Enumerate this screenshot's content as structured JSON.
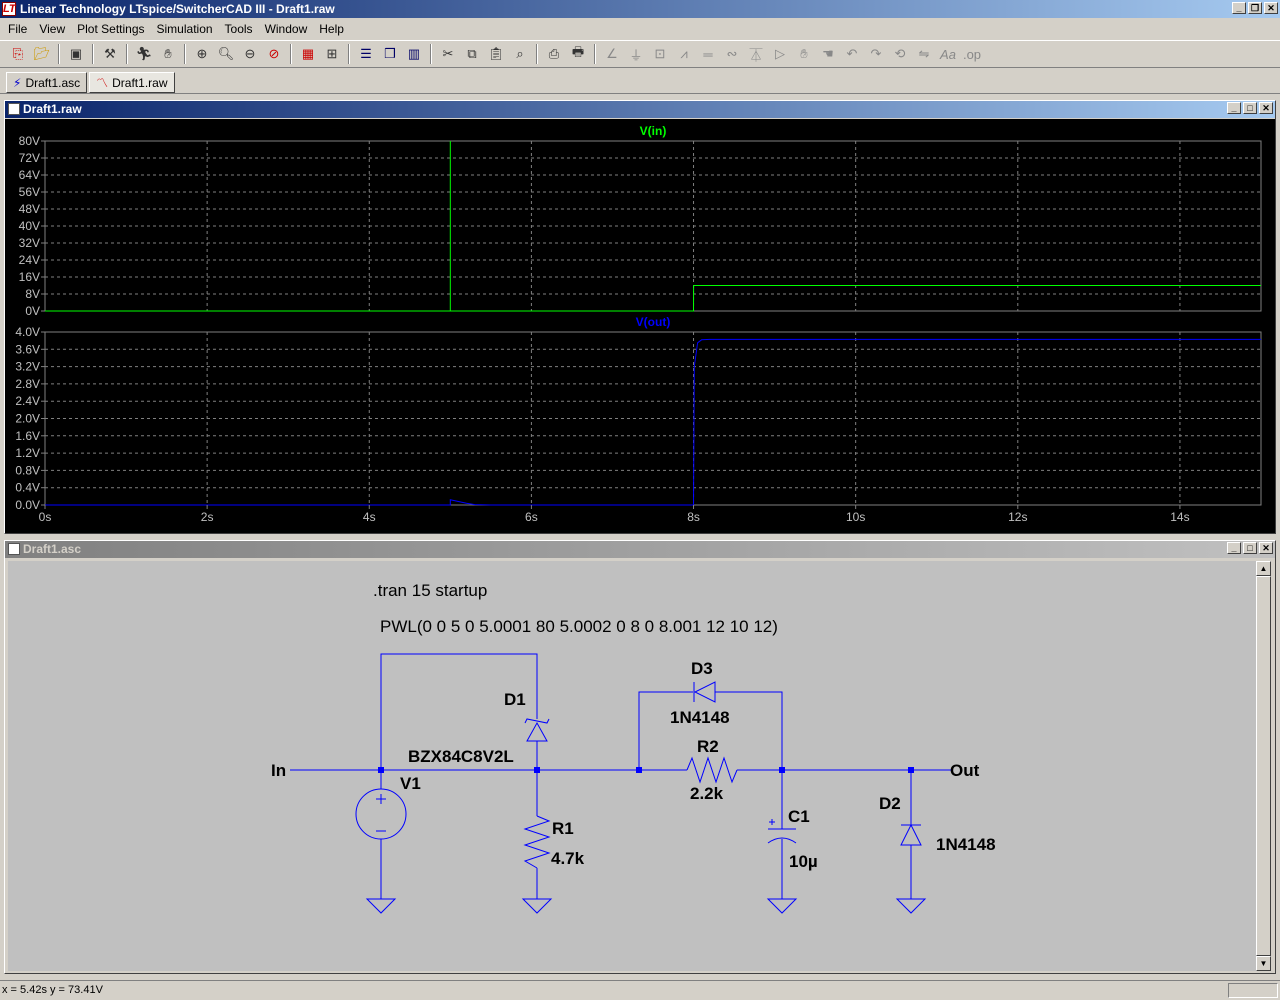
{
  "window": {
    "title": "Linear Technology LTspice/SwitcherCAD III - Draft1.raw",
    "app_icon": "LT"
  },
  "menu": [
    "File",
    "View",
    "Plot Settings",
    "Simulation",
    "Tools",
    "Window",
    "Help"
  ],
  "toolbar_icons": [
    "new-schematic-icon",
    "open-icon",
    "save-icon",
    "control-panel-icon",
    "run-icon",
    "pan-icon",
    "zoom-in-icon",
    "zoom-area-icon",
    "zoom-out-icon",
    "zoom-cancel-icon",
    "autorange-icon",
    "grid-icon",
    "tile-horizontal-icon",
    "cascade-icon",
    "tile-vertical-icon",
    "cut-icon",
    "copy-icon",
    "paste-icon",
    "find-icon",
    "print-preview-icon",
    "print-icon",
    "wire-icon",
    "ground-icon",
    "label-icon",
    "resistor-icon",
    "capacitor-icon",
    "inductor-icon",
    "diode-icon",
    "component-icon",
    "move-icon",
    "drag-icon",
    "undo-icon",
    "redo-icon",
    "rotate-icon",
    "mirror-icon",
    "text-icon",
    "spice-directive-icon"
  ],
  "tabs": [
    {
      "label": "Draft1.asc",
      "active": false
    },
    {
      "label": "Draft1.raw",
      "active": true
    }
  ],
  "plot_window": {
    "title": "Draft1.raw"
  },
  "schematic_window": {
    "title": "Draft1.asc"
  },
  "chart_data": [
    {
      "type": "line",
      "title": "V(in)",
      "series": [
        {
          "name": "V(in)",
          "color": "#00ff00",
          "x": [
            0,
            5,
            5.0001,
            5.0002,
            8,
            8.001,
            10,
            15
          ],
          "y": [
            0,
            0,
            80,
            0,
            0,
            12,
            12,
            12
          ]
        }
      ],
      "xlim": [
        0,
        15
      ],
      "ylim": [
        0,
        80
      ],
      "yticks": [
        0,
        8,
        16,
        24,
        32,
        40,
        48,
        56,
        64,
        72,
        80
      ],
      "ytick_labels": [
        "0V",
        "8V",
        "16V",
        "24V",
        "32V",
        "40V",
        "48V",
        "56V",
        "64V",
        "72V",
        "80V"
      ],
      "grid": true
    },
    {
      "type": "line",
      "title": "V(out)",
      "series": [
        {
          "name": "V(out)",
          "color": "#0000ff",
          "x": [
            0,
            5,
            5.0002,
            5.1,
            5.2,
            5.3,
            5.5,
            8,
            8.01,
            8.05,
            8.1,
            8.2,
            15
          ],
          "y": [
            0,
            0,
            0.12,
            0.08,
            0.04,
            0.01,
            0,
            0,
            3.2,
            3.75,
            3.82,
            3.83,
            3.83
          ]
        }
      ],
      "xlim": [
        0,
        15
      ],
      "ylim": [
        0,
        4
      ],
      "yticks": [
        0,
        0.4,
        0.8,
        1.2,
        1.6,
        2.0,
        2.4,
        2.8,
        3.2,
        3.6,
        4.0
      ],
      "ytick_labels": [
        "0.0V",
        "0.4V",
        "0.8V",
        "1.2V",
        "1.6V",
        "2.0V",
        "2.4V",
        "2.8V",
        "3.2V",
        "3.6V",
        "4.0V"
      ],
      "xticks": [
        0,
        2,
        4,
        6,
        8,
        10,
        12,
        14
      ],
      "xtick_labels": [
        "0s",
        "2s",
        "4s",
        "6s",
        "8s",
        "10s",
        "12s",
        "14s"
      ],
      "grid": true
    }
  ],
  "schematic": {
    "directive": ".tran 15 startup",
    "source_value": "PWL(0 0 5 0 5.0001 80 5.0002 0 8 0 8.001 12 10 12)",
    "labels": {
      "in": "In",
      "out": "Out"
    },
    "components": {
      "v1": {
        "ref": "V1"
      },
      "d1": {
        "ref": "D1",
        "value": "BZX84C8V2L"
      },
      "r1": {
        "ref": "R1",
        "value": "4.7k"
      },
      "d3": {
        "ref": "D3",
        "value": "1N4148"
      },
      "r2": {
        "ref": "R2",
        "value": "2.2k"
      },
      "c1": {
        "ref": "C1",
        "value": "10µ"
      },
      "d2": {
        "ref": "D2",
        "value": "1N4148"
      }
    },
    "wire_color": "#0000ff"
  },
  "status": {
    "cursor": "x = 5.42s    y = 73.41V"
  }
}
